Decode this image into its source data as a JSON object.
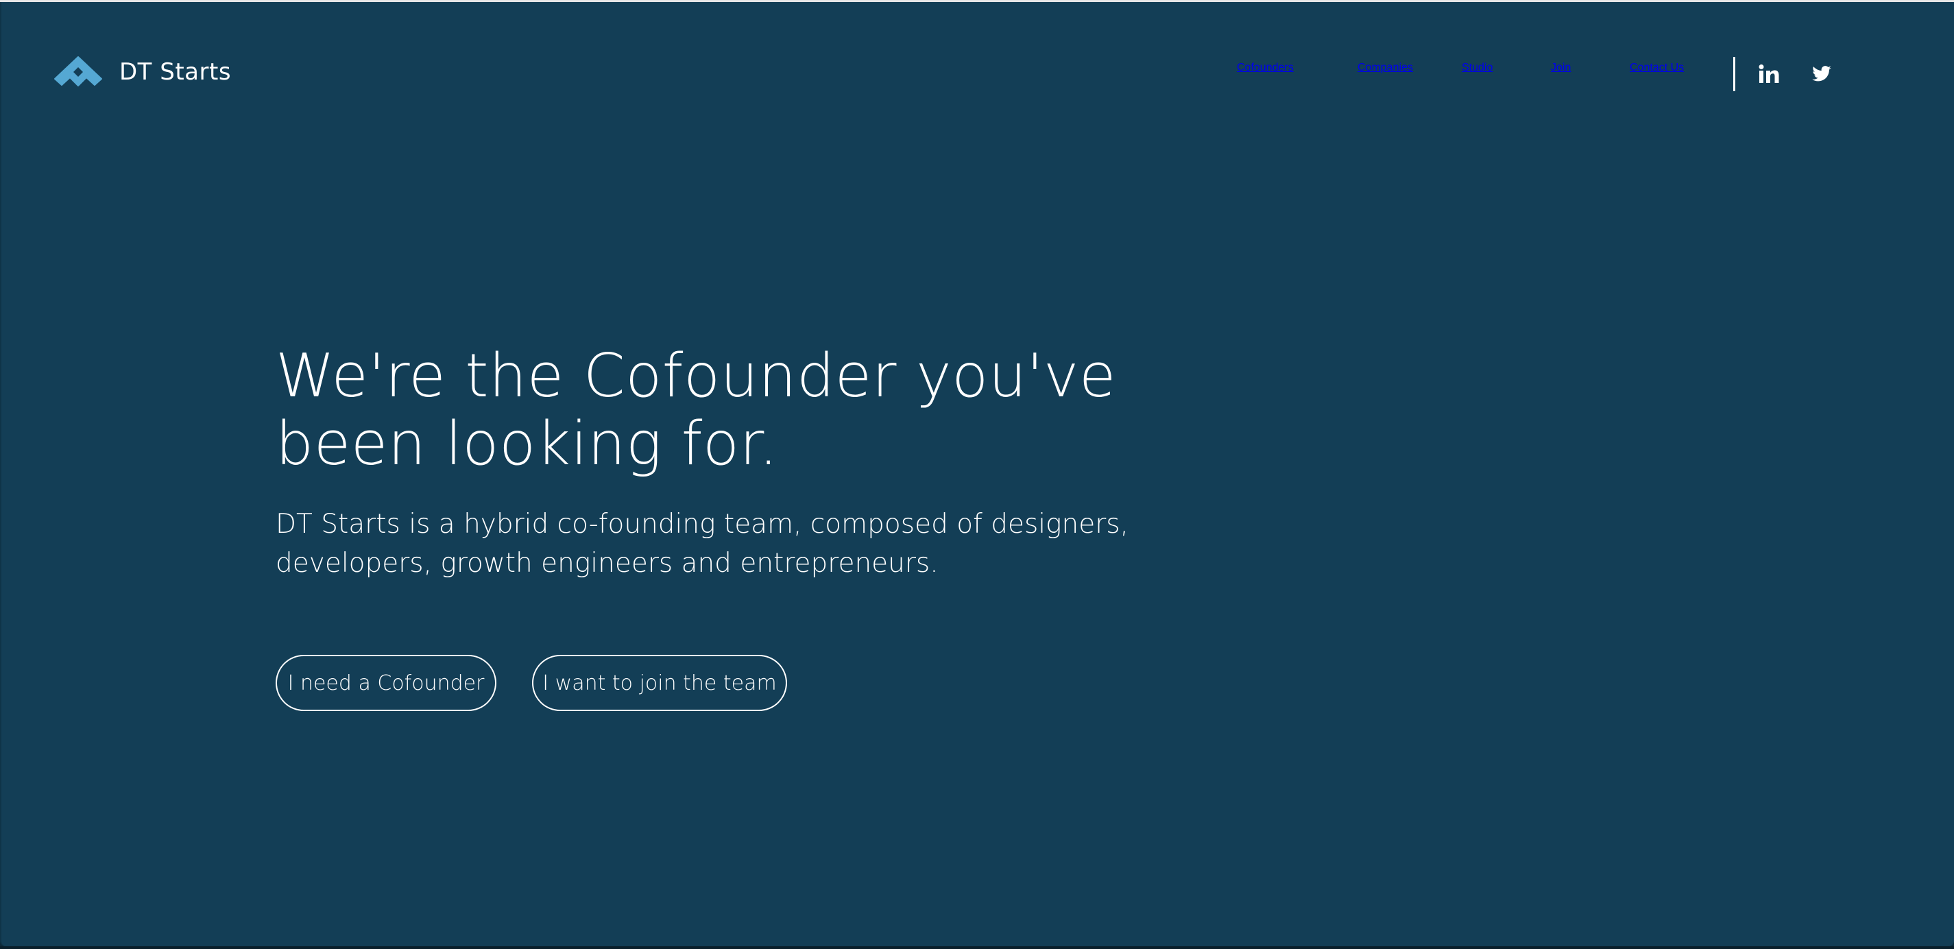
{
  "brand": {
    "name": "DT Starts",
    "logo_icon": "diamond-roof-logo-icon",
    "logo_color": "#55a8d3"
  },
  "colors": {
    "background": "#133e56",
    "text": "#ffffff",
    "accent": "#55a8d3"
  },
  "nav": {
    "items": [
      {
        "label": "Cofounders"
      },
      {
        "label": "Companies"
      },
      {
        "label": "Studio"
      },
      {
        "label": "Join"
      },
      {
        "label": "Contact Us"
      }
    ],
    "social": [
      {
        "name": "LinkedIn",
        "icon": "linkedin-icon"
      },
      {
        "name": "Twitter",
        "icon": "twitter-icon"
      }
    ]
  },
  "hero": {
    "title": "We're the Cofounder you've\nbeen looking for.",
    "subtitle": "DT Starts is a hybrid co-founding team, composed of designers, developers, growth engineers and entrepreneurs.",
    "buttons": [
      {
        "label": "I need a Cofounder"
      },
      {
        "label": "I want to join the team"
      }
    ]
  }
}
